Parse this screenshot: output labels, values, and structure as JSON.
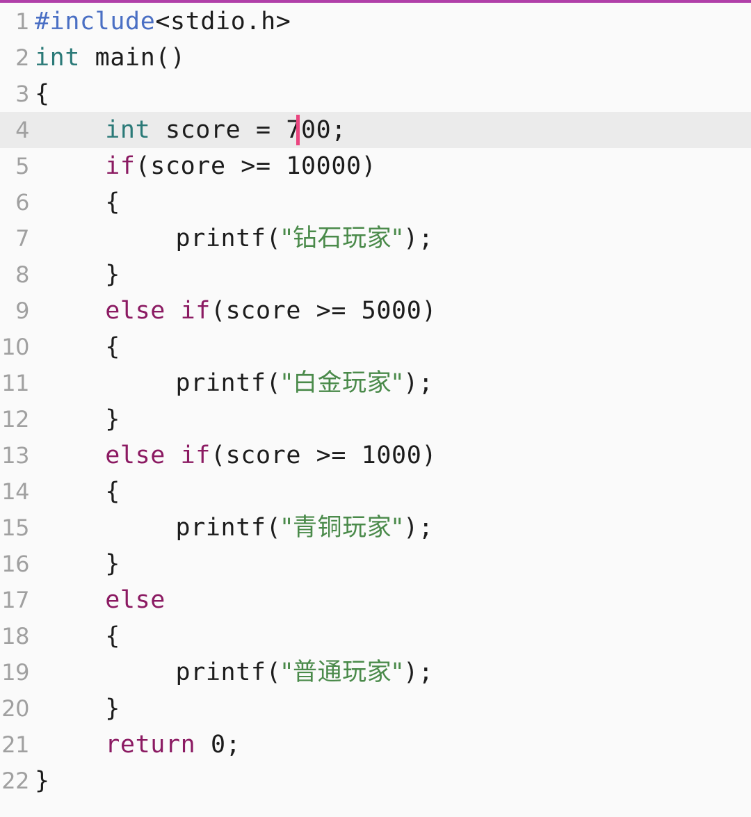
{
  "editor": {
    "background_color": "#fafafa",
    "active_line_color": "#ebebeb",
    "top_rule_color": "#b03fa8",
    "cursor_color": "#ea457f",
    "language": "c",
    "active_line_number": 4,
    "cursor_line": 4,
    "cursor_column": 16
  },
  "palette": {
    "preprocessor": "#4a6fc4",
    "type": "#2b7a78",
    "keyword": "#8b1a62",
    "string": "#4a8a4a",
    "plain": "#1c1c1c",
    "line_number": "#a0a0a0"
  },
  "lines": [
    {
      "number": "1",
      "indent": 0,
      "active": false,
      "tokens": [
        {
          "text": "#include",
          "kind": "pre"
        },
        {
          "text": "<stdio.h>",
          "kind": "plain"
        }
      ]
    },
    {
      "number": "2",
      "indent": 0,
      "active": false,
      "tokens": [
        {
          "text": "int",
          "kind": "type"
        },
        {
          "text": " main()",
          "kind": "plain"
        }
      ]
    },
    {
      "number": "3",
      "indent": 0,
      "active": false,
      "tokens": [
        {
          "text": "{",
          "kind": "plain"
        }
      ]
    },
    {
      "number": "4",
      "indent": 1,
      "active": true,
      "cursor_after_chars": 13,
      "tokens": [
        {
          "text": "int",
          "kind": "type"
        },
        {
          "text": " score = 700;",
          "kind": "plain"
        }
      ]
    },
    {
      "number": "5",
      "indent": 1,
      "active": false,
      "tokens": [
        {
          "text": "if",
          "kind": "kw"
        },
        {
          "text": "(score >= 10000)",
          "kind": "plain"
        }
      ]
    },
    {
      "number": "6",
      "indent": 1,
      "active": false,
      "tokens": [
        {
          "text": "{",
          "kind": "plain"
        }
      ]
    },
    {
      "number": "7",
      "indent": 2,
      "active": false,
      "tokens": [
        {
          "text": "printf(",
          "kind": "plain"
        },
        {
          "text": "\"钻石玩家\"",
          "kind": "str"
        },
        {
          "text": ");",
          "kind": "plain"
        }
      ]
    },
    {
      "number": "8",
      "indent": 1,
      "active": false,
      "tokens": [
        {
          "text": "}",
          "kind": "plain"
        }
      ]
    },
    {
      "number": "9",
      "indent": 1,
      "active": false,
      "tokens": [
        {
          "text": "else if",
          "kind": "kw"
        },
        {
          "text": "(score >= 5000)",
          "kind": "plain"
        }
      ]
    },
    {
      "number": "10",
      "indent": 1,
      "active": false,
      "tokens": [
        {
          "text": "{",
          "kind": "plain"
        }
      ]
    },
    {
      "number": "11",
      "indent": 2,
      "active": false,
      "tokens": [
        {
          "text": "printf(",
          "kind": "plain"
        },
        {
          "text": "\"白金玩家\"",
          "kind": "str"
        },
        {
          "text": ");",
          "kind": "plain"
        }
      ]
    },
    {
      "number": "12",
      "indent": 1,
      "active": false,
      "tokens": [
        {
          "text": "}",
          "kind": "plain"
        }
      ]
    },
    {
      "number": "13",
      "indent": 1,
      "active": false,
      "tokens": [
        {
          "text": "else if",
          "kind": "kw"
        },
        {
          "text": "(score >= 1000)",
          "kind": "plain"
        }
      ]
    },
    {
      "number": "14",
      "indent": 1,
      "active": false,
      "tokens": [
        {
          "text": "{",
          "kind": "plain"
        }
      ]
    },
    {
      "number": "15",
      "indent": 2,
      "active": false,
      "tokens": [
        {
          "text": "printf(",
          "kind": "plain"
        },
        {
          "text": "\"青铜玩家\"",
          "kind": "str"
        },
        {
          "text": ");",
          "kind": "plain"
        }
      ]
    },
    {
      "number": "16",
      "indent": 1,
      "active": false,
      "tokens": [
        {
          "text": "}",
          "kind": "plain"
        }
      ]
    },
    {
      "number": "17",
      "indent": 1,
      "active": false,
      "tokens": [
        {
          "text": "else",
          "kind": "kw"
        }
      ]
    },
    {
      "number": "18",
      "indent": 1,
      "active": false,
      "tokens": [
        {
          "text": "{",
          "kind": "plain"
        }
      ]
    },
    {
      "number": "19",
      "indent": 2,
      "active": false,
      "tokens": [
        {
          "text": "printf(",
          "kind": "plain"
        },
        {
          "text": "\"普通玩家\"",
          "kind": "str"
        },
        {
          "text": ");",
          "kind": "plain"
        }
      ]
    },
    {
      "number": "20",
      "indent": 1,
      "active": false,
      "tokens": [
        {
          "text": "}",
          "kind": "plain"
        }
      ]
    },
    {
      "number": "21",
      "indent": 1,
      "active": false,
      "tokens": [
        {
          "text": "return",
          "kind": "kw"
        },
        {
          "text": " 0;",
          "kind": "plain"
        }
      ]
    },
    {
      "number": "22",
      "indent": 0,
      "active": false,
      "tokens": [
        {
          "text": "}",
          "kind": "plain"
        }
      ]
    }
  ]
}
